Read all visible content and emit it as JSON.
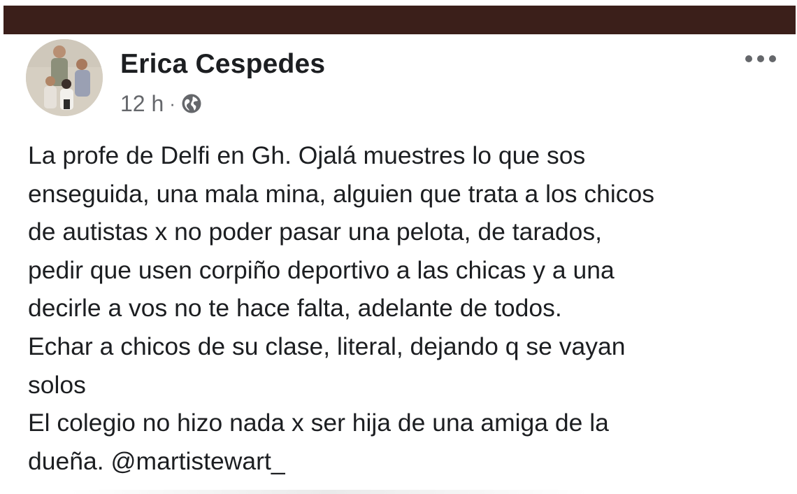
{
  "post": {
    "author": "Erica Cespedes",
    "time": "12 h",
    "separator": "·",
    "privacy_icon": "globe-icon",
    "more_icon": "more-options-icon",
    "lines": [
      "La profe de Delfi en Gh. Ojalá muestres lo que sos",
      "enseguida, una mala mina, alguien que trata a los chicos",
      "de autistas x no poder pasar una pelota, de tarados,",
      "pedir que usen corpiño deportivo a las chicas y a una",
      "decirle a vos no te hace falta, adelante de todos.",
      "Echar a chicos de su clase, literal, dejando q se vayan",
      "solos",
      "El colegio no hizo nada x ser hija de una amiga de la",
      "dueña."
    ],
    "mention": "@martistewart_"
  },
  "colors": {
    "top_bar": "#3b1f1a",
    "name": "#1c1e21",
    "meta": "#65676b",
    "text": "#1c1e21"
  }
}
